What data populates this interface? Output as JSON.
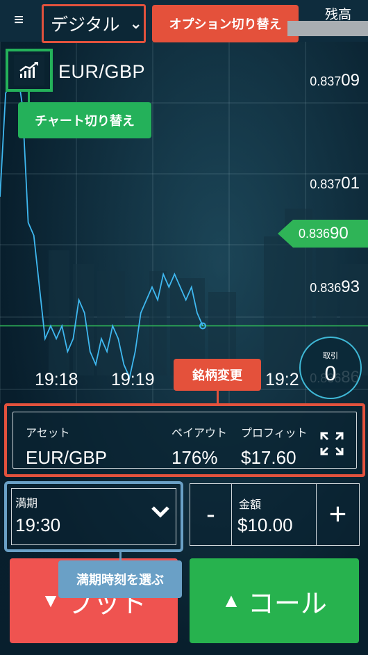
{
  "colors": {
    "accent_red": "#e2523d",
    "accent_green": "#24b15a",
    "accent_blue": "#6aa0c6",
    "put": "#ef5350",
    "call": "#27b24e",
    "chart_line": "#3fb8f0"
  },
  "topbar": {
    "menu_icon": "hamburger-icon",
    "mode_value": "デジタル",
    "mode_callout": "オプション切り替え",
    "balance_label": "残高"
  },
  "chart_header": {
    "chart_icon": "chart-icon",
    "asset": "EUR/GBP",
    "chart_callout": "チャート切り替え"
  },
  "price_axis": [
    {
      "small": "0.837",
      "big": "09"
    },
    {
      "small": "0.837",
      "big": "01"
    },
    {
      "small": "0.836",
      "big": "93"
    },
    {
      "small": "0.836",
      "big": "86"
    }
  ],
  "current_price": {
    "small": "0.836",
    "big": "90"
  },
  "time_axis": [
    "19:18",
    "19:19",
    "19:2"
  ],
  "trades": {
    "label": "取引",
    "count": "0"
  },
  "asset_callout": "銘柄変更",
  "asset_panel": {
    "asset_header": "アセット",
    "asset_value": "EUR/GBP",
    "payout_header": "ペイアウト",
    "payout_value": "176%",
    "profit_header": "プロフィット",
    "profit_value": "$17.60",
    "expand_icon": "expand-icon"
  },
  "expiry": {
    "header": "満期",
    "value": "19:30",
    "callout": "満期時刻を選ぶ"
  },
  "amount": {
    "minus": "-",
    "header": "金額",
    "value": "$10.00",
    "plus": "+"
  },
  "buttons": {
    "put_arrow": "▼",
    "put_label": "プット",
    "call_arrow": "▲",
    "call_label": "コール"
  },
  "chart_data": {
    "type": "line",
    "series": [
      {
        "values": [
          0.837,
          0.83708,
          0.83709,
          0.8371,
          0.83707,
          0.83698,
          0.83697,
          0.83693,
          0.83689,
          0.8369,
          0.83689,
          0.8369,
          0.83688,
          0.83689,
          0.83692,
          0.83691,
          0.83688,
          0.83687,
          0.83689,
          0.83688,
          0.8369,
          0.83689,
          0.83687,
          0.83686,
          0.83688,
          0.83691,
          0.83692,
          0.83693,
          0.83692,
          0.83694,
          0.83693,
          0.83694,
          0.83693,
          0.83692,
          0.83693,
          0.83691,
          0.8369
        ]
      }
    ],
    "ylim": [
      0.83684,
      0.83712
    ],
    "xlabel": "",
    "ylabel": ""
  }
}
